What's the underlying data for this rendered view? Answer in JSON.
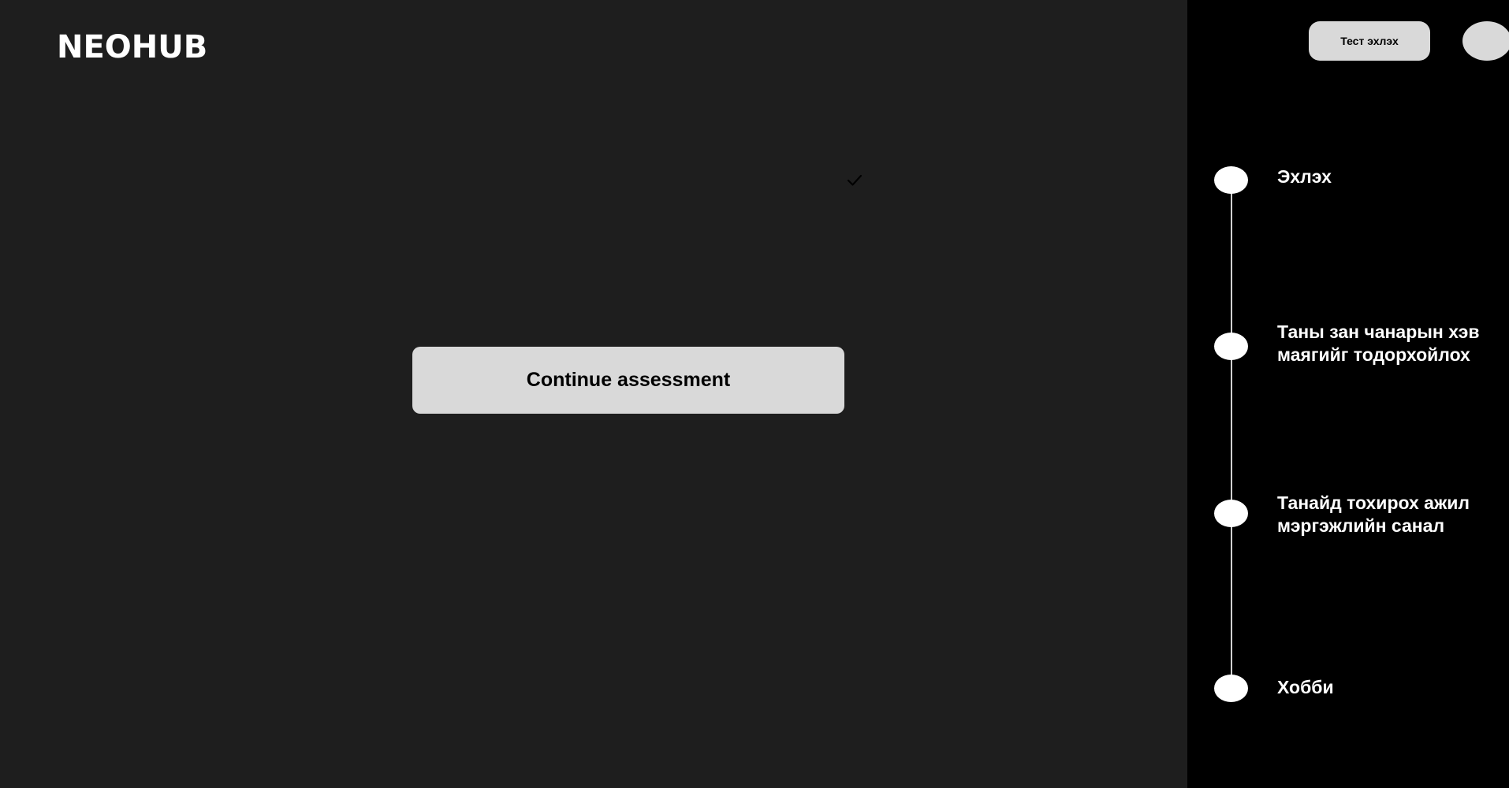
{
  "header": {
    "logo_text": "NEOHUB"
  },
  "main": {
    "check_icon": "checkmark-icon",
    "continue_label": "Continue assessment"
  },
  "sidebar": {
    "start_test_label": "Тест эхлэх",
    "avatar_icon": "avatar",
    "steps": [
      {
        "label": "Эхлэх"
      },
      {
        "label": "Таны зан чанарын хэв\n маягийг тодорхойлох"
      },
      {
        "label": "Танайд тохирох ажил\nмэргэжлийн санал"
      },
      {
        "label": "Хобби"
      }
    ]
  },
  "colors": {
    "main_bg": "#1e1e1e",
    "sidebar_bg": "#000000",
    "button_bg": "#d9d9d9",
    "text_light": "#ffffff",
    "text_dark": "#000000"
  }
}
